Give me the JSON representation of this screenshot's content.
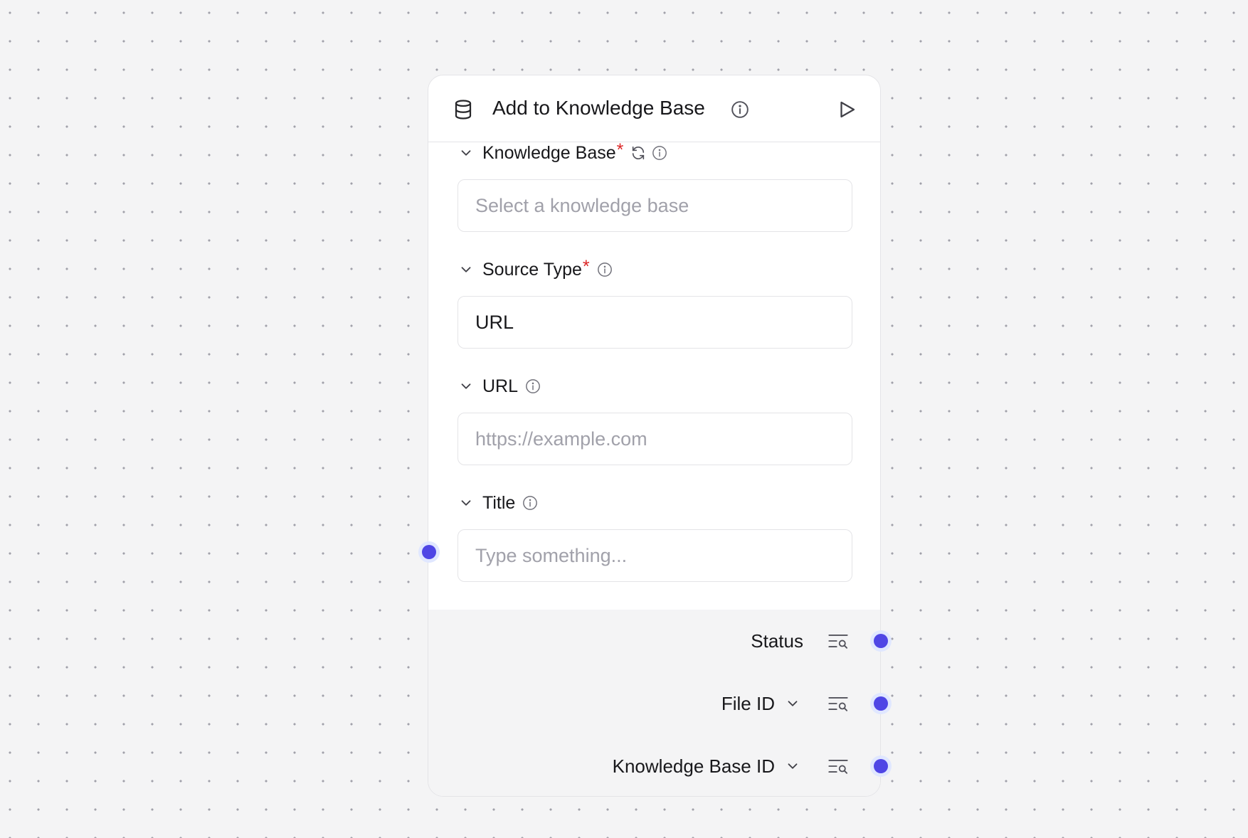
{
  "node": {
    "title": "Add to Knowledge Base",
    "header_icons": [
      "database-icon",
      "info-icon",
      "play-icon"
    ],
    "fields": [
      {
        "label": "Knowledge Base",
        "required": true,
        "required_mark": "*",
        "icons": [
          "refresh-icon",
          "info-icon"
        ],
        "placeholder": "Select a knowledge base",
        "value": ""
      },
      {
        "label": "Source Type",
        "required": true,
        "required_mark": "*",
        "icons": [
          "info-icon"
        ],
        "placeholder": "",
        "value": "URL"
      },
      {
        "label": "URL",
        "required": false,
        "icons": [
          "info-icon"
        ],
        "placeholder": "https://example.com",
        "value": ""
      },
      {
        "label": "Title",
        "required": false,
        "icons": [
          "info-icon"
        ],
        "placeholder": "Type something...",
        "value": ""
      }
    ],
    "outputs": [
      {
        "label": "Status",
        "expandable": false
      },
      {
        "label": "File ID",
        "expandable": true
      },
      {
        "label": "Knowledge Base ID",
        "expandable": true
      }
    ]
  },
  "colors": {
    "canvas_background": "#f4f4f5",
    "canvas_dot": "#a1a1aa",
    "node_background": "#ffffff",
    "border": "#e4e4e7",
    "handle": "#4f46e5",
    "handle_ring": "#e0e7ff",
    "required_mark": "#dc2626",
    "placeholder_text": "#a1a1aa",
    "icon": "#52525b"
  }
}
